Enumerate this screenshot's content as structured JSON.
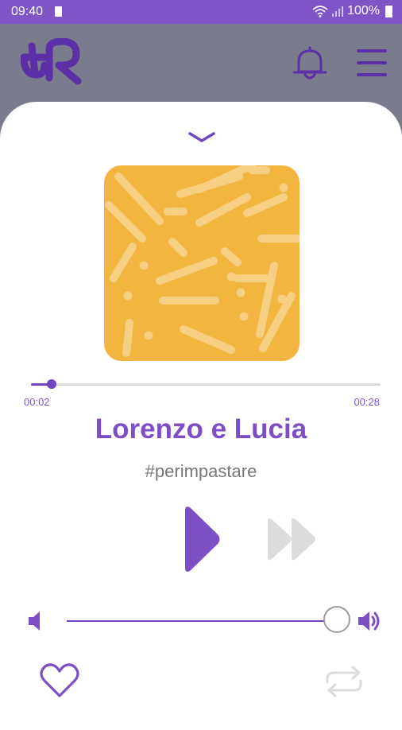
{
  "status_bar": {
    "time": "09:40",
    "battery": "100%"
  },
  "player": {
    "title": "Lorenzo e Lucia",
    "tag": "#perimpastare",
    "elapsed": "00:02",
    "duration": "00:28",
    "progress": 0.06,
    "volume": 1.0
  },
  "icons": {
    "logo": "app-logo",
    "notifications": "bell-icon",
    "menu": "hamburger-menu-icon",
    "collapse": "chevron-down-icon",
    "play": "play-icon",
    "next": "skip-next-icon",
    "volume_low": "volume-low-icon",
    "volume_high": "volume-high-icon",
    "favorite": "heart-icon",
    "repeat": "repeat-icon"
  },
  "colors": {
    "accent": "#7d4fc7",
    "cover": "#f2b53f",
    "disabled": "#dcdcdc"
  }
}
